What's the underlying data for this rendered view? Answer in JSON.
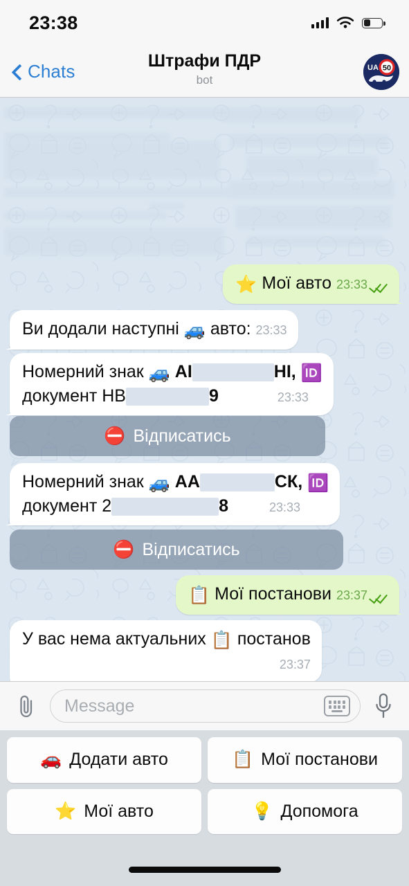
{
  "status_bar": {
    "time": "23:38",
    "signal_icon": "cellular-signal-icon",
    "wifi_icon": "wifi-icon",
    "battery_icon": "battery-icon",
    "battery_level_pct": 33
  },
  "nav": {
    "back_label": "Chats",
    "back_icon": "chevron-left-icon",
    "title": "Штрафи ПДР",
    "subtitle": "bot",
    "avatar_icon": "bot-avatar-icon",
    "avatar_text_country": "UA",
    "avatar_text_speed": "50"
  },
  "colors": {
    "accent_blue": "#2d7fd3",
    "chat_background": "#dbe6f0",
    "incoming_bubble": "#ffffff",
    "outgoing_bubble": "#e3f7c8",
    "inline_button": "#6c7e94",
    "tick_green": "#49a014",
    "redaction": "#d9e2ed"
  },
  "messages": [
    {
      "id": "m1",
      "side": "out",
      "emoji": "⭐",
      "emoji_name": "star-emoji",
      "text": "Мої авто",
      "time": "23:33",
      "read": true
    },
    {
      "id": "m2",
      "side": "in",
      "text_before": "Ви додали наступні",
      "emoji": "🚙",
      "emoji_name": "car-emoji",
      "text_after": "авто:",
      "time": "23:33"
    },
    {
      "id": "m3",
      "side": "in",
      "line1_before": "Номерний знак",
      "emoji": "🚙",
      "emoji_name": "car-emoji",
      "plate_prefix": "АІ",
      "plate_redacted": true,
      "plate_suffix": "НІ,",
      "id_emoji": "🆔",
      "id_emoji_name": "id-emoji",
      "line2_before": "документ НВ",
      "doc_redacted": true,
      "doc_suffix": "9",
      "time": "23:33"
    },
    {
      "id": "b1",
      "type": "inline_button",
      "emoji": "⛔",
      "emoji_name": "no-entry-emoji",
      "label": "Відписатись"
    },
    {
      "id": "m4",
      "side": "in",
      "line1_before": "Номерний знак",
      "emoji": "🚙",
      "emoji_name": "car-emoji",
      "plate_prefix": "АА",
      "plate_redacted": true,
      "plate_suffix": "СК,",
      "id_emoji": "🆔",
      "id_emoji_name": "id-emoji",
      "line2_before": "документ 2",
      "doc_redacted": true,
      "doc_suffix": "8",
      "time": "23:33"
    },
    {
      "id": "b2",
      "type": "inline_button",
      "emoji": "⛔",
      "emoji_name": "no-entry-emoji",
      "label": "Відписатись"
    },
    {
      "id": "m5",
      "side": "out",
      "emoji": "📋",
      "emoji_name": "clipboard-emoji",
      "text": "Мої постанови",
      "time": "23:37",
      "read": true
    },
    {
      "id": "m6",
      "side": "in",
      "text_before": "У вас нема актуальних",
      "emoji": "📋",
      "emoji_name": "clipboard-emoji",
      "text_after": "постанов",
      "time": "23:37"
    }
  ],
  "input_bar": {
    "attach_icon": "paperclip-icon",
    "placeholder": "Message",
    "keyboard_icon": "keyboard-icon",
    "mic_icon": "microphone-icon",
    "value": ""
  },
  "reply_keyboard": {
    "buttons": [
      {
        "emoji": "🚗",
        "emoji_name": "red-car-emoji",
        "label": "Додати авто"
      },
      {
        "emoji": "📋",
        "emoji_name": "clipboard-emoji",
        "label": "Мої постанови"
      },
      {
        "emoji": "⭐",
        "emoji_name": "star-emoji",
        "label": "Мої авто"
      },
      {
        "emoji": "💡",
        "emoji_name": "bulb-emoji",
        "label": "Допомога"
      }
    ]
  },
  "home_indicator": "home-indicator-bar"
}
